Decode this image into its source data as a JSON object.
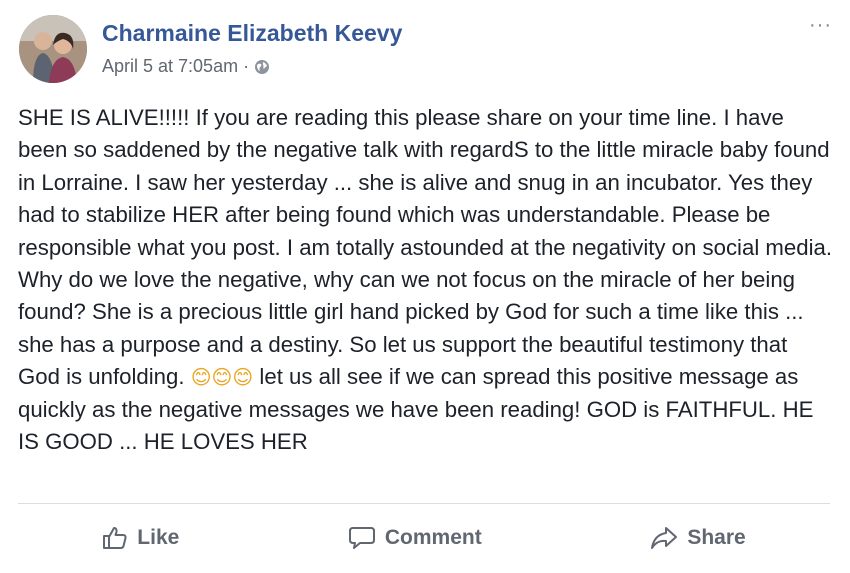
{
  "post": {
    "author": "Charmaine Elizabeth Keevy",
    "date": "April 5 at 7:05am",
    "separator": "·",
    "privacy_icon": "globe-icon",
    "more_label": "···",
    "text_part1": "SHE IS ALIVE!!!!! If you are reading this please share on your time line. I have been so saddened by the negative talk with regardS to the little miracle baby found in Lorraine. I saw her yesterday ... she is alive and snug in an incubator. Yes they had to stabilize HER after being found which was understandable. Please be responsible what you post. I am totally astounded at the negativity on social media. Why do we love the negative, why can we not focus on the miracle of her being found? She is a precious little girl hand picked by God for such a time like this ... she has a purpose and a destiny. So let us support the beautiful testimony that God is unfolding.",
    "emojis": "😊😊😊",
    "text_part2": "let us all see if we can spread this positive message as quickly as the negative messages we have been reading! GOD is FAITHFUL. HE IS GOOD ... HE LOVES HER"
  },
  "actions": {
    "like": "Like",
    "comment": "Comment",
    "share": "Share"
  },
  "colors": {
    "author_link": "#365899",
    "meta_text": "#616770",
    "action_text": "#606770",
    "divider": "#dadde1"
  }
}
